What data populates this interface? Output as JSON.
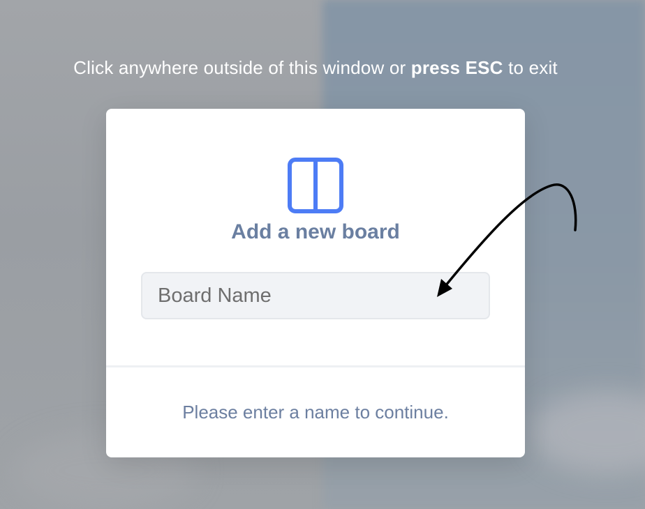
{
  "overlay": {
    "hint_prefix": "Click anywhere outside of this window or ",
    "hint_bold": "press ESC",
    "hint_suffix": " to exit"
  },
  "modal": {
    "icon": "board-columns-icon",
    "title": "Add a new board",
    "input": {
      "placeholder": "Board Name",
      "value": ""
    },
    "footer_message": "Please enter a name to continue."
  },
  "colors": {
    "accent": "#4d7cf5",
    "title": "#6a7fa1",
    "footer_text": "#6c7fa0",
    "input_bg": "#f1f3f6"
  }
}
